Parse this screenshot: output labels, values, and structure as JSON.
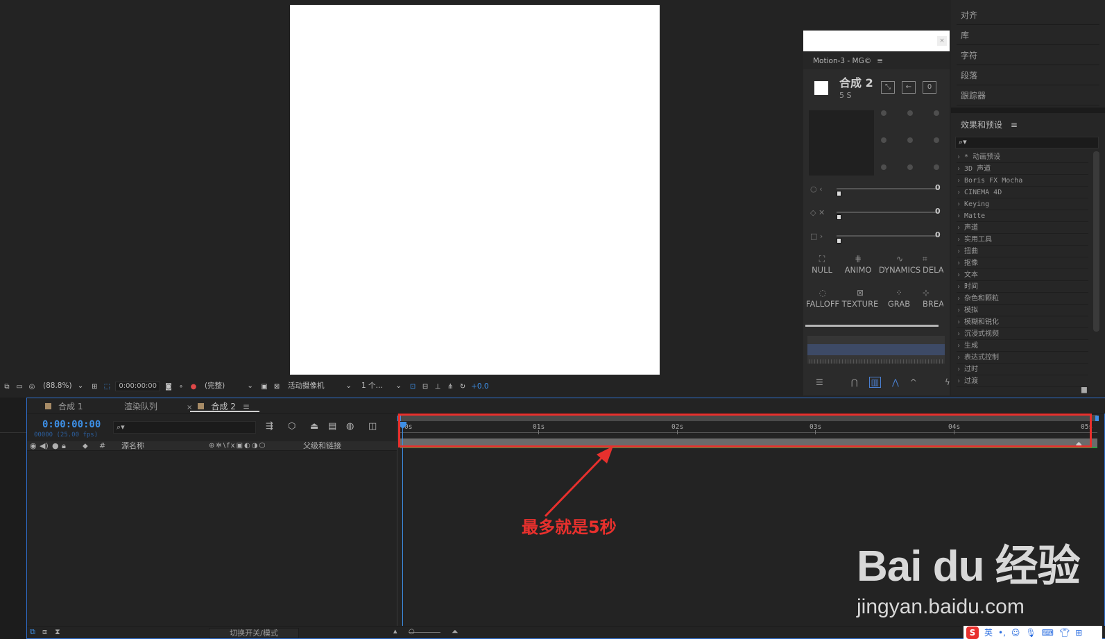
{
  "viewer_toolbar": {
    "zoom": "(88.8%)",
    "timecode": "0:00:00:00",
    "resolution": "(完整)",
    "camera": "活动摄像机",
    "views": "1 个…",
    "exposure": "+0.0"
  },
  "motion": {
    "title": "Motion-3 - MG©",
    "menu": "≡",
    "comp_name": "合成 2",
    "comp_duration": "5 S",
    "slider_values": [
      "0",
      "0",
      "0"
    ],
    "buttons_row1": [
      "NULL",
      "ANIMO",
      "DYNAMICS",
      "DELA"
    ],
    "buttons_row2": [
      "FALLOFF",
      "TEXTURE",
      "GRAB",
      "BREA"
    ]
  },
  "right_panel": {
    "items": [
      "对齐",
      "库",
      "字符",
      "段落",
      "跟踪器"
    ],
    "effects_title": "效果和预设",
    "effects_menu": "≡",
    "search_icon": "⌕▾",
    "effects": [
      "* 动画预设",
      "3D 声道",
      "Boris FX Mocha",
      "CINEMA 4D",
      "Keying",
      "Matte",
      "声道",
      "实用工具",
      "扭曲",
      "抠像",
      "文本",
      "时间",
      "杂色和颗粒",
      "模拟",
      "模糊和锐化",
      "沉浸式视频",
      "生成",
      "表达式控制",
      "过时",
      "过渡"
    ]
  },
  "timeline": {
    "tabs": [
      "合成 1",
      "渲染队列",
      "合成 2"
    ],
    "tab_close": "×",
    "tab_menu": "≡",
    "timecode": "0:00:00:00",
    "fps": "00000 (25.00 fps)",
    "search_icon": "⌕▾",
    "header": {
      "hash": "#",
      "source_name": "源名称",
      "parent": "父级和链接"
    },
    "ruler_labels": [
      "0s",
      "01s",
      "02s",
      "03s",
      "04s",
      "05s"
    ],
    "switch_label": "切换开关/模式"
  },
  "annotation": "最多就是5秒",
  "watermark": {
    "main": "Bai du 经验",
    "url": "jingyan.baidu.com"
  },
  "ime": {
    "logo": "S",
    "lang": "英"
  },
  "colors": {
    "accent_blue": "#3d8fe6",
    "highlight_red": "#e8302d",
    "panel_bg": "#232323"
  }
}
